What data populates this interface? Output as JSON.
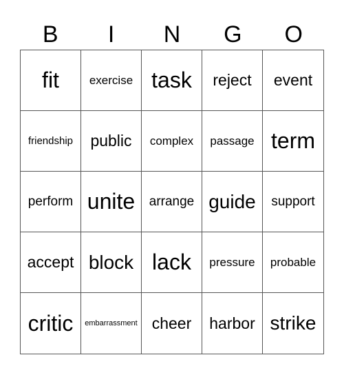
{
  "header": [
    "B",
    "I",
    "N",
    "G",
    "O"
  ],
  "cells": [
    "fit",
    "exercise",
    "task",
    "reject",
    "event",
    "friendship",
    "public",
    "complex",
    "passage",
    "term",
    "perform",
    "unite",
    "arrange",
    "guide",
    "support",
    "accept",
    "block",
    "lack",
    "pressure",
    "probable",
    "critic",
    "embarrassment",
    "cheer",
    "harbor",
    "strike"
  ]
}
